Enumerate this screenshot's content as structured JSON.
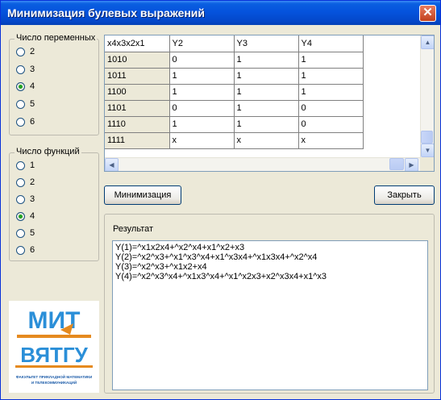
{
  "window": {
    "title": "Минимизация булевых выражений",
    "close_symbol": "✕"
  },
  "variables_group": {
    "label": "Число переменных",
    "options": [
      "2",
      "3",
      "4",
      "5",
      "6"
    ],
    "selected": "4"
  },
  "functions_group": {
    "label": "Число функций",
    "options": [
      "1",
      "2",
      "3",
      "4",
      "5",
      "6"
    ],
    "selected": "4"
  },
  "grid": {
    "headers": [
      "x4x3x2x1",
      "Y2",
      "Y3",
      "Y4"
    ],
    "rows": [
      [
        "1010",
        "0",
        "1",
        "1"
      ],
      [
        "1011",
        "1",
        "1",
        "1"
      ],
      [
        "1100",
        "1",
        "1",
        "1"
      ],
      [
        "1101",
        "0",
        "1",
        "0"
      ],
      [
        "1110",
        "1",
        "1",
        "0"
      ],
      [
        "1111",
        "x",
        "x",
        "x"
      ]
    ]
  },
  "buttons": {
    "minimize": "Минимизация",
    "close": "Закрыть"
  },
  "result": {
    "label": "Результат",
    "lines": [
      "Y(1)=^x1x2x4+^x2^x4+x1^x2+x3",
      "Y(2)=^x2^x3+^x1^x3^x4+x1^x3x4+^x1x3x4+^x2^x4",
      "Y(3)=^x2^x3+^x1x2+x4",
      "Y(4)=^x2^x3^x4+^x1x3^x4+^x1^x2x3+x2^x3x4+x1^x3"
    ]
  },
  "logo": {
    "top_letters": "МИТ",
    "main_text": "ВЯТГУ",
    "caption_1": "ФАКУЛЬТЕТ ПРИКЛАДНОЙ МАТЕМАТИКИ",
    "caption_2": "И ТЕЛЕКОММУНИКАЦИЙ"
  },
  "colors": {
    "titlebar": "#0553dd",
    "window_bg": "#ece9d8",
    "radio_selected": "#21a121",
    "logo_blue": "#2b8fd8",
    "logo_orange": "#e58a1f"
  }
}
